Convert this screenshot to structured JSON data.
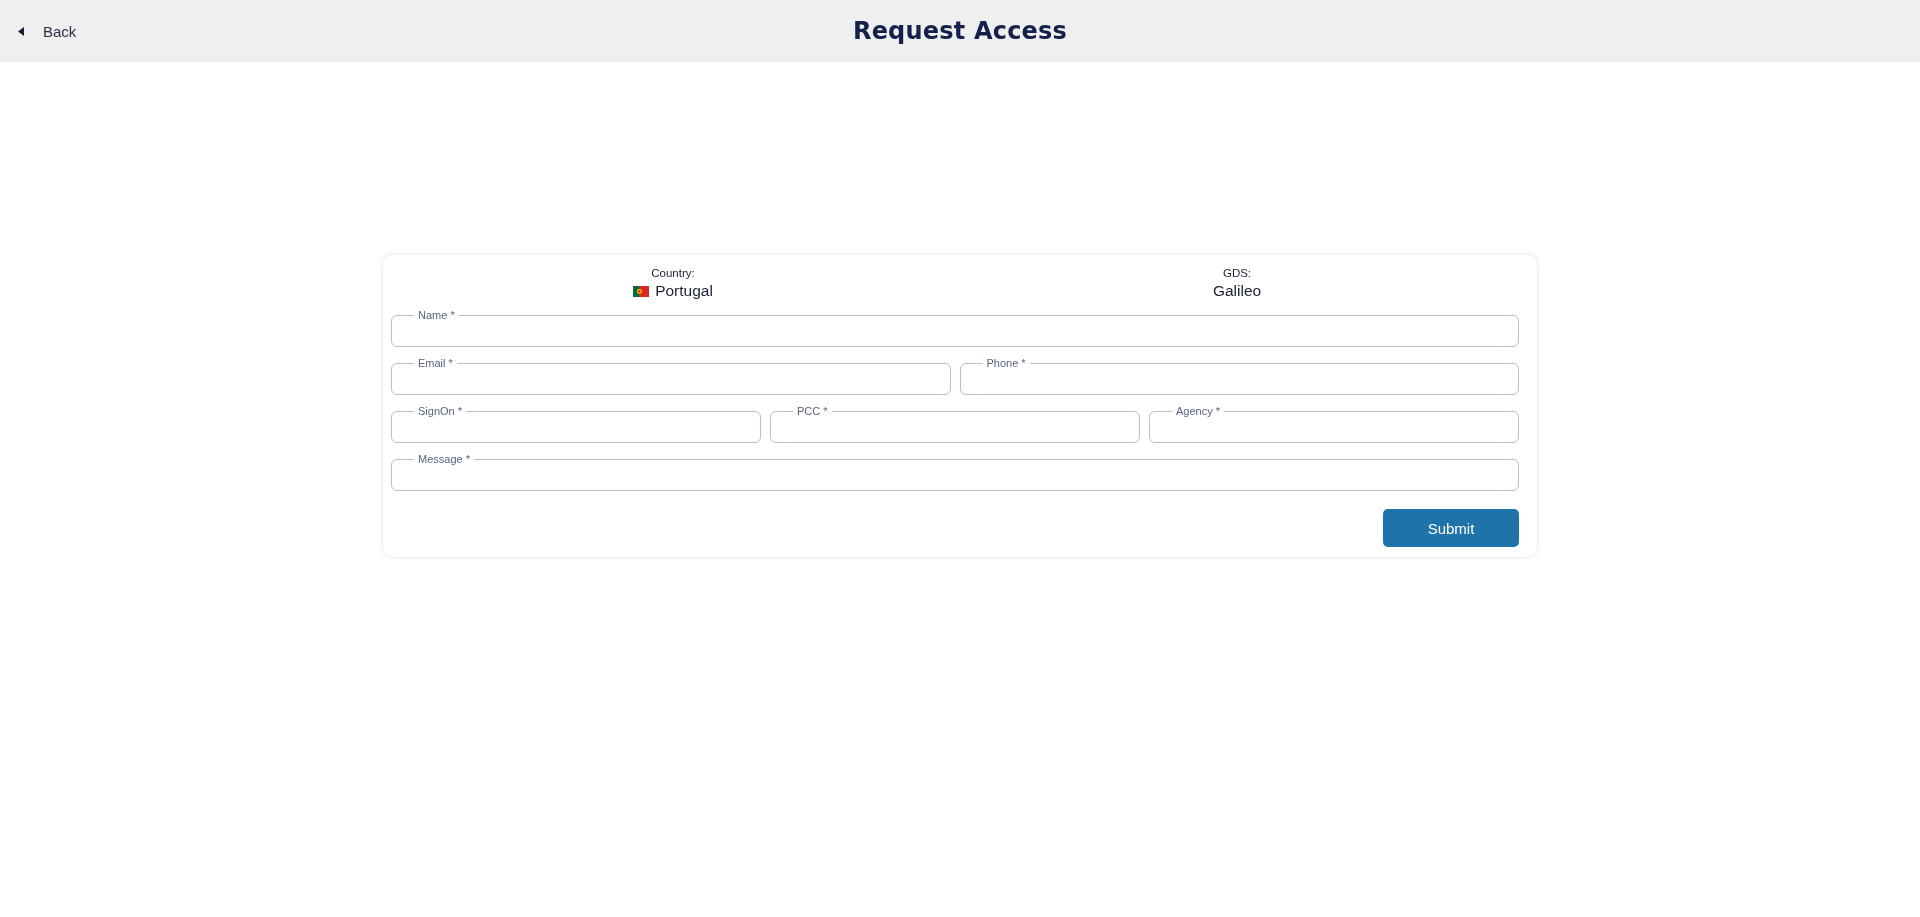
{
  "header": {
    "back": {
      "label": "Back"
    },
    "title": "Request Access"
  },
  "form": {
    "info": [
      {
        "label": "Country:",
        "value": "Portugal",
        "kind": "flag"
      },
      {
        "label": "GDS:",
        "value": "Galileo",
        "kind": "plain"
      }
    ],
    "rows": [
      {
        "fields": [
          {
            "label": "Name *"
          }
        ]
      },
      {
        "fields": [
          {
            "label": "Email *"
          },
          {
            "label": "Phone *"
          }
        ]
      },
      {
        "fields": [
          {
            "label": "SignOn *"
          },
          {
            "label": "PCC *"
          },
          {
            "label": "Agency *"
          }
        ]
      },
      {
        "fields": [
          {
            "label": "Message *"
          }
        ]
      }
    ],
    "submit": {
      "label": "Submit"
    }
  }
}
